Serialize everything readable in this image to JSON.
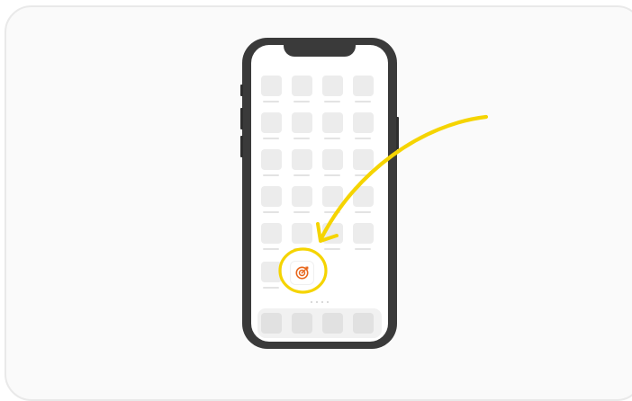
{
  "illustration": {
    "highlighted_app_icon": "target-icon",
    "pointer_icon": "arrow-icon",
    "colors": {
      "card_background": "#fafafa",
      "phone_body": "#3a3a3a",
      "app_placeholder": "#ececec",
      "highlight_yellow": "#f5d400",
      "target_orange": "#e8671c"
    }
  }
}
